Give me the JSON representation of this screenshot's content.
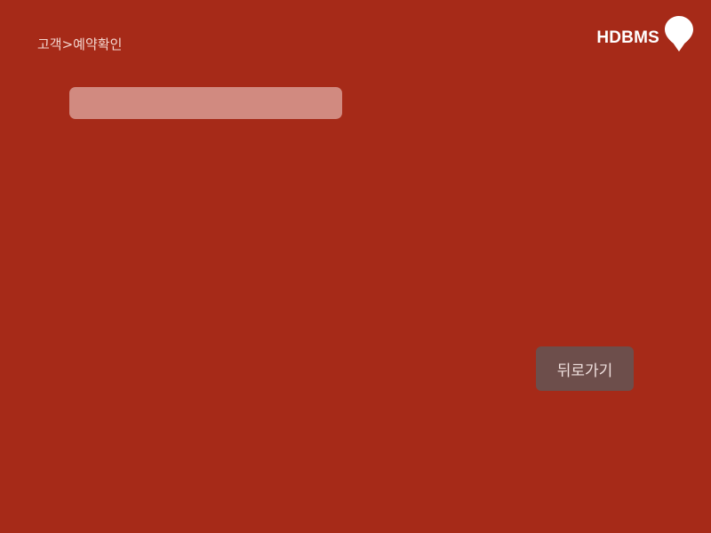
{
  "header": {
    "breadcrumb": "고객>예약확인",
    "brand_name": "HDBMS",
    "brand_icon": "map-pin-icon"
  },
  "search": {
    "value": "",
    "placeholder": ""
  },
  "actions": {
    "back_label": "뒤로가기"
  },
  "colors": {
    "background": "#a62a18",
    "search_bar": "#d18a80",
    "back_button": "#6d4e4b",
    "brand_text": "#ffffff"
  }
}
